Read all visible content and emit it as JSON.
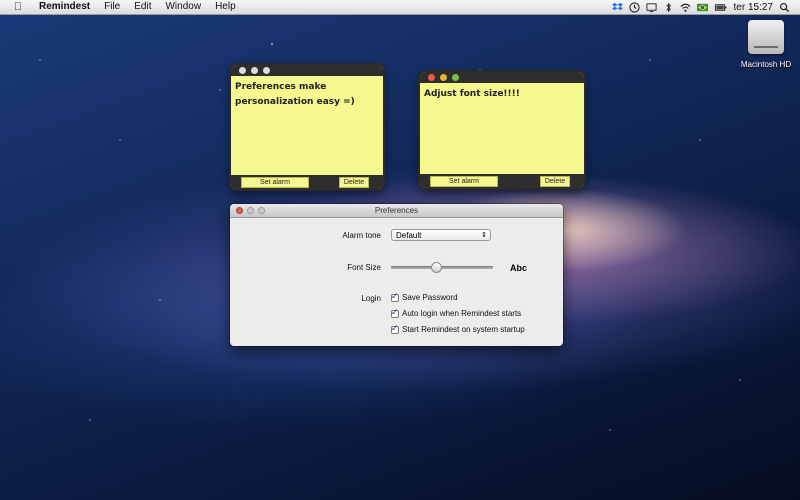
{
  "menubar": {
    "app": "Remindest",
    "items": [
      "File",
      "Edit",
      "Window",
      "Help"
    ],
    "clock": "ter 15:27"
  },
  "desktop": {
    "hd_label": "Macintosh HD"
  },
  "notes": [
    {
      "text": "Preferences make personalization easy =)",
      "alarm_label": "Set alarm",
      "delete_label": "Delete"
    },
    {
      "text": "Adjust font size!!!!",
      "alarm_label": "Set alarm",
      "delete_label": "Delete"
    }
  ],
  "preferences": {
    "title": "Preferences",
    "alarm_tone_label": "Alarm tone",
    "alarm_tone_value": "Default",
    "font_size_label": "Font Size",
    "font_size_sample": "Abc",
    "font_size_level": 0.44,
    "login_label": "Login",
    "options": [
      {
        "label": "Save Password",
        "checked": true
      },
      {
        "label": "Auto login when Remindest starts",
        "checked": true
      },
      {
        "label": "Start Remindest on system startup",
        "checked": true
      }
    ]
  }
}
